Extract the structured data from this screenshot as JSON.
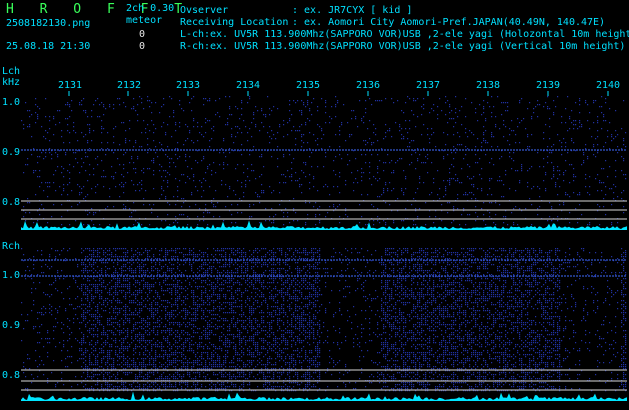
{
  "header": {
    "logo": "H R O F F T",
    "mode": "2ch 0.30",
    "filename": "2508182130.png",
    "datetime": "25.08.18 21:30",
    "meteor_label": "meteor",
    "meteor_l": "0",
    "meteor_r": "0",
    "info_labels": [
      "Ovserver",
      "Receiving Location",
      "L-ch",
      "R-ch"
    ],
    "observer_value": ": ex. JR7CYX [ kid ]",
    "location_value": ": ex. Aomori City Aomori-Pref.JAPAN(40.49N, 140.47E)",
    "lch_value": ":ex. UV5R 113.900Mhz(SAPPORO VOR)USB ,2-ele yagi (Holozontal 10m height)",
    "rch_value": ":ex. UV5R 113.900Mhz(SAPPORO VOR)USB ,2-ele yagi (Vertical 10m height)"
  },
  "panels": {
    "lch": {
      "label": "Lch",
      "unit": "kHz",
      "yticks": [
        "1.0",
        "0.9",
        "0.8"
      ]
    },
    "rch": {
      "label": "Rch",
      "yticks": [
        "1.0",
        "0.9",
        "0.8"
      ]
    }
  },
  "time_axis": {
    "ticks": [
      "2131",
      "2132",
      "2133",
      "2134",
      "2135",
      "2136",
      "2137",
      "2138",
      "2139",
      "2140"
    ]
  },
  "colors": {
    "background": "#000000",
    "noise": "#2030a0",
    "signal_line": "#3f6cff",
    "level_trace": "#00e5ff",
    "ref_lines": "#d8d8d8",
    "text_cyan": "#00e0ff",
    "logo": "#39ff5a"
  },
  "rch_activity": {
    "active_minutes": [
      1,
      2,
      3,
      4,
      6,
      7,
      8,
      10
    ],
    "quiet_minutes": [
      0,
      5,
      9
    ]
  }
}
